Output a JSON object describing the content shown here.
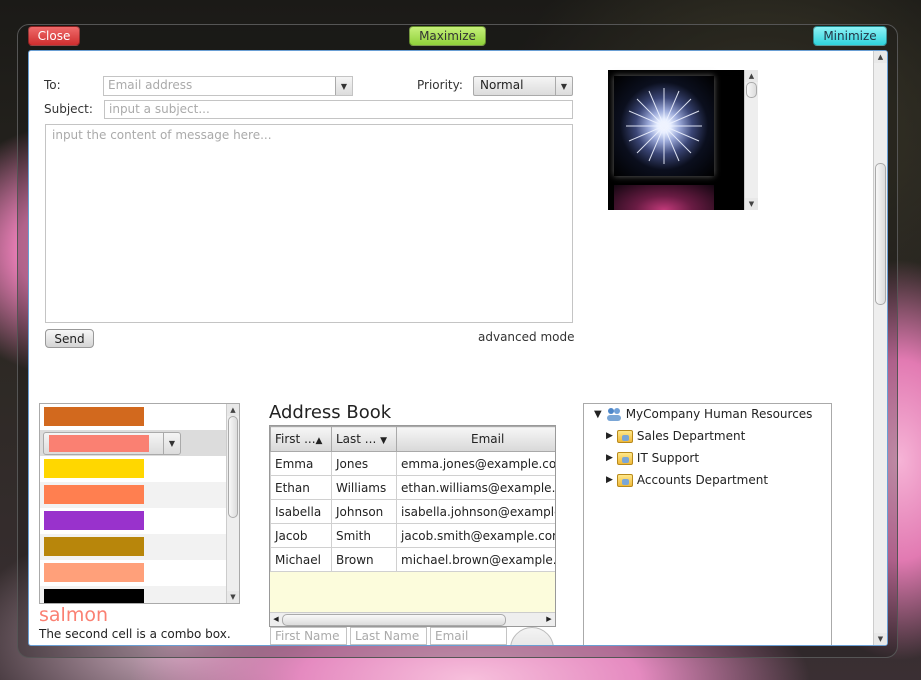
{
  "window": {
    "close_label": "Close",
    "maximize_label": "Maximize",
    "minimize_label": "Minimize"
  },
  "compose": {
    "to_label": "To:",
    "to_placeholder": "Email address",
    "priority_label": "Priority:",
    "priority_value": "Normal",
    "subject_label": "Subject:",
    "subject_placeholder": "input a subject...",
    "body_placeholder": "input the content of message here...",
    "send_label": "Send",
    "advanced_label": "advanced mode"
  },
  "color_list": {
    "items": [
      {
        "name": "chocolate",
        "hex": "#d2691e"
      },
      {
        "name": "salmon",
        "hex": "#fa8072"
      },
      {
        "name": "gold",
        "hex": "#ffd700"
      },
      {
        "name": "coral",
        "hex": "#ff7f50"
      },
      {
        "name": "darkorchid",
        "hex": "#9932cc"
      },
      {
        "name": "darkgoldenrod",
        "hex": "#b8860b"
      },
      {
        "name": "lightsalmon",
        "hex": "#ffa07a"
      },
      {
        "name": "black",
        "hex": "#000000"
      }
    ],
    "selected_name": "salmon",
    "selected_color": "#fa8072",
    "caption": "The second cell is a combo box."
  },
  "address_book": {
    "title": "Address Book",
    "columns": [
      "First ...",
      "Last ...",
      "Email"
    ],
    "rows": [
      {
        "first": "Emma",
        "last": "Jones",
        "email": "emma.jones@example.com"
      },
      {
        "first": "Ethan",
        "last": "Williams",
        "email": "ethan.williams@example.com"
      },
      {
        "first": "Isabella",
        "last": "Johnson",
        "email": "isabella.johnson@example.com"
      },
      {
        "first": "Jacob",
        "last": "Smith",
        "email": "jacob.smith@example.com"
      },
      {
        "first": "Michael",
        "last": "Brown",
        "email": "michael.brown@example.com"
      }
    ],
    "input_first_placeholder": "First Name",
    "input_last_placeholder": "Last Name",
    "input_email_placeholder": "Email"
  },
  "tree": {
    "root": "MyCompany Human Resources",
    "children": [
      "Sales Department",
      "IT Support",
      "Accounts Department"
    ]
  }
}
